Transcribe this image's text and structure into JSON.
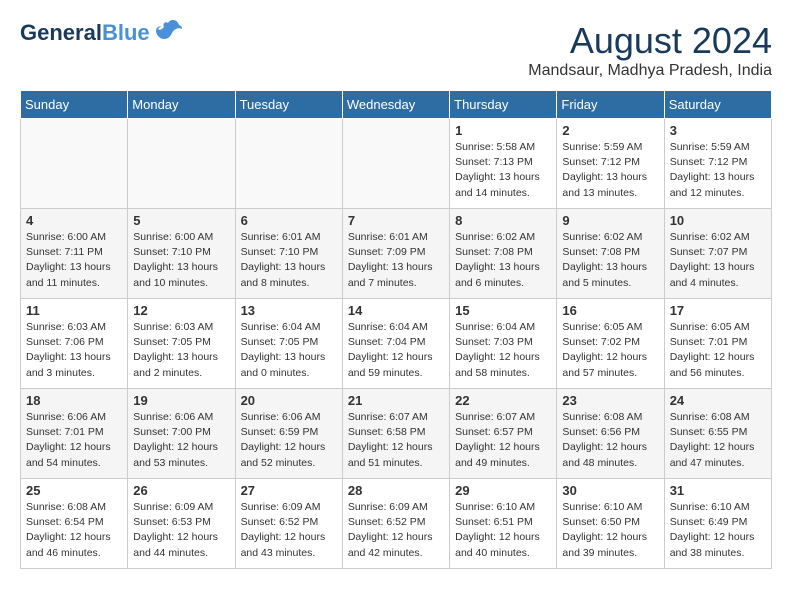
{
  "header": {
    "logo_general": "General",
    "logo_blue": "Blue",
    "month_year": "August 2024",
    "location": "Mandsaur, Madhya Pradesh, India"
  },
  "weekdays": [
    "Sunday",
    "Monday",
    "Tuesday",
    "Wednesday",
    "Thursday",
    "Friday",
    "Saturday"
  ],
  "weeks": [
    [
      {
        "day": "",
        "sunrise": "",
        "sunset": "",
        "daylight": ""
      },
      {
        "day": "",
        "sunrise": "",
        "sunset": "",
        "daylight": ""
      },
      {
        "day": "",
        "sunrise": "",
        "sunset": "",
        "daylight": ""
      },
      {
        "day": "",
        "sunrise": "",
        "sunset": "",
        "daylight": ""
      },
      {
        "day": "1",
        "sunrise": "Sunrise: 5:58 AM",
        "sunset": "Sunset: 7:13 PM",
        "daylight": "Daylight: 13 hours and 14 minutes."
      },
      {
        "day": "2",
        "sunrise": "Sunrise: 5:59 AM",
        "sunset": "Sunset: 7:12 PM",
        "daylight": "Daylight: 13 hours and 13 minutes."
      },
      {
        "day": "3",
        "sunrise": "Sunrise: 5:59 AM",
        "sunset": "Sunset: 7:12 PM",
        "daylight": "Daylight: 13 hours and 12 minutes."
      }
    ],
    [
      {
        "day": "4",
        "sunrise": "Sunrise: 6:00 AM",
        "sunset": "Sunset: 7:11 PM",
        "daylight": "Daylight: 13 hours and 11 minutes."
      },
      {
        "day": "5",
        "sunrise": "Sunrise: 6:00 AM",
        "sunset": "Sunset: 7:10 PM",
        "daylight": "Daylight: 13 hours and 10 minutes."
      },
      {
        "day": "6",
        "sunrise": "Sunrise: 6:01 AM",
        "sunset": "Sunset: 7:10 PM",
        "daylight": "Daylight: 13 hours and 8 minutes."
      },
      {
        "day": "7",
        "sunrise": "Sunrise: 6:01 AM",
        "sunset": "Sunset: 7:09 PM",
        "daylight": "Daylight: 13 hours and 7 minutes."
      },
      {
        "day": "8",
        "sunrise": "Sunrise: 6:02 AM",
        "sunset": "Sunset: 7:08 PM",
        "daylight": "Daylight: 13 hours and 6 minutes."
      },
      {
        "day": "9",
        "sunrise": "Sunrise: 6:02 AM",
        "sunset": "Sunset: 7:08 PM",
        "daylight": "Daylight: 13 hours and 5 minutes."
      },
      {
        "day": "10",
        "sunrise": "Sunrise: 6:02 AM",
        "sunset": "Sunset: 7:07 PM",
        "daylight": "Daylight: 13 hours and 4 minutes."
      }
    ],
    [
      {
        "day": "11",
        "sunrise": "Sunrise: 6:03 AM",
        "sunset": "Sunset: 7:06 PM",
        "daylight": "Daylight: 13 hours and 3 minutes."
      },
      {
        "day": "12",
        "sunrise": "Sunrise: 6:03 AM",
        "sunset": "Sunset: 7:05 PM",
        "daylight": "Daylight: 13 hours and 2 minutes."
      },
      {
        "day": "13",
        "sunrise": "Sunrise: 6:04 AM",
        "sunset": "Sunset: 7:05 PM",
        "daylight": "Daylight: 13 hours and 0 minutes."
      },
      {
        "day": "14",
        "sunrise": "Sunrise: 6:04 AM",
        "sunset": "Sunset: 7:04 PM",
        "daylight": "Daylight: 12 hours and 59 minutes."
      },
      {
        "day": "15",
        "sunrise": "Sunrise: 6:04 AM",
        "sunset": "Sunset: 7:03 PM",
        "daylight": "Daylight: 12 hours and 58 minutes."
      },
      {
        "day": "16",
        "sunrise": "Sunrise: 6:05 AM",
        "sunset": "Sunset: 7:02 PM",
        "daylight": "Daylight: 12 hours and 57 minutes."
      },
      {
        "day": "17",
        "sunrise": "Sunrise: 6:05 AM",
        "sunset": "Sunset: 7:01 PM",
        "daylight": "Daylight: 12 hours and 56 minutes."
      }
    ],
    [
      {
        "day": "18",
        "sunrise": "Sunrise: 6:06 AM",
        "sunset": "Sunset: 7:01 PM",
        "daylight": "Daylight: 12 hours and 54 minutes."
      },
      {
        "day": "19",
        "sunrise": "Sunrise: 6:06 AM",
        "sunset": "Sunset: 7:00 PM",
        "daylight": "Daylight: 12 hours and 53 minutes."
      },
      {
        "day": "20",
        "sunrise": "Sunrise: 6:06 AM",
        "sunset": "Sunset: 6:59 PM",
        "daylight": "Daylight: 12 hours and 52 minutes."
      },
      {
        "day": "21",
        "sunrise": "Sunrise: 6:07 AM",
        "sunset": "Sunset: 6:58 PM",
        "daylight": "Daylight: 12 hours and 51 minutes."
      },
      {
        "day": "22",
        "sunrise": "Sunrise: 6:07 AM",
        "sunset": "Sunset: 6:57 PM",
        "daylight": "Daylight: 12 hours and 49 minutes."
      },
      {
        "day": "23",
        "sunrise": "Sunrise: 6:08 AM",
        "sunset": "Sunset: 6:56 PM",
        "daylight": "Daylight: 12 hours and 48 minutes."
      },
      {
        "day": "24",
        "sunrise": "Sunrise: 6:08 AM",
        "sunset": "Sunset: 6:55 PM",
        "daylight": "Daylight: 12 hours and 47 minutes."
      }
    ],
    [
      {
        "day": "25",
        "sunrise": "Sunrise: 6:08 AM",
        "sunset": "Sunset: 6:54 PM",
        "daylight": "Daylight: 12 hours and 46 minutes."
      },
      {
        "day": "26",
        "sunrise": "Sunrise: 6:09 AM",
        "sunset": "Sunset: 6:53 PM",
        "daylight": "Daylight: 12 hours and 44 minutes."
      },
      {
        "day": "27",
        "sunrise": "Sunrise: 6:09 AM",
        "sunset": "Sunset: 6:52 PM",
        "daylight": "Daylight: 12 hours and 43 minutes."
      },
      {
        "day": "28",
        "sunrise": "Sunrise: 6:09 AM",
        "sunset": "Sunset: 6:52 PM",
        "daylight": "Daylight: 12 hours and 42 minutes."
      },
      {
        "day": "29",
        "sunrise": "Sunrise: 6:10 AM",
        "sunset": "Sunset: 6:51 PM",
        "daylight": "Daylight: 12 hours and 40 minutes."
      },
      {
        "day": "30",
        "sunrise": "Sunrise: 6:10 AM",
        "sunset": "Sunset: 6:50 PM",
        "daylight": "Daylight: 12 hours and 39 minutes."
      },
      {
        "day": "31",
        "sunrise": "Sunrise: 6:10 AM",
        "sunset": "Sunset: 6:49 PM",
        "daylight": "Daylight: 12 hours and 38 minutes."
      }
    ]
  ]
}
